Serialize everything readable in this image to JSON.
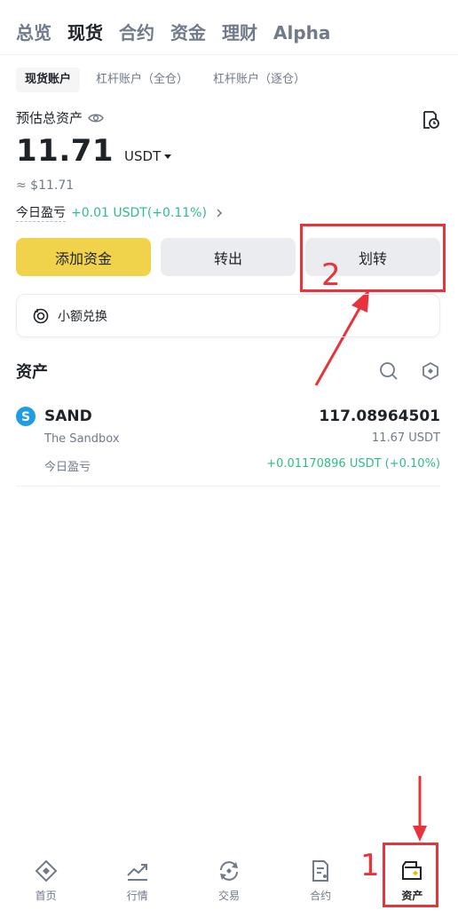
{
  "top_tabs": [
    {
      "label": "总览",
      "active": false
    },
    {
      "label": "现货",
      "active": true
    },
    {
      "label": "合约",
      "active": false
    },
    {
      "label": "资金",
      "active": false
    },
    {
      "label": "理财",
      "active": false
    },
    {
      "label": "Alpha",
      "active": false
    }
  ],
  "account_tabs": [
    {
      "label": "现货账户",
      "active": true
    },
    {
      "label": "杠杆账户（全仓）",
      "active": false
    },
    {
      "label": "杠杆账户（逐仓）",
      "active": false
    }
  ],
  "summary": {
    "label": "预估总资产",
    "balance": "11.71",
    "unit": "USDT",
    "fiat": "≈ $11.71",
    "pnl_label": "今日盈亏",
    "pnl_value": "+0.01 USDT(+0.11%)"
  },
  "actions": {
    "add_funds": "添加资金",
    "withdraw": "转出",
    "transfer": "划转"
  },
  "convert": {
    "label": "小额兑换"
  },
  "assets": {
    "title": "资产",
    "items": [
      {
        "symbol": "SAND",
        "name": "The Sandbox",
        "amount": "117.08964501",
        "value": "11.67 USDT",
        "pnl_label": "今日盈亏",
        "pnl_value": "+0.01170896 USDT (+0.10%)"
      }
    ]
  },
  "bottom_nav": [
    {
      "label": "首页",
      "icon": "home-icon",
      "active": false
    },
    {
      "label": "行情",
      "icon": "markets-icon",
      "active": false
    },
    {
      "label": "交易",
      "icon": "trade-icon",
      "active": false
    },
    {
      "label": "合约",
      "icon": "futures-icon",
      "active": false
    },
    {
      "label": "资产",
      "icon": "wallet-icon",
      "active": true
    }
  ],
  "annotations": {
    "step1": "1",
    "step2": "2"
  },
  "colors": {
    "accent_yellow": "#f0d34a",
    "positive_green": "#2ebd85",
    "annotation_red": "#e8333a",
    "coin_blue": "#1f9de3"
  }
}
